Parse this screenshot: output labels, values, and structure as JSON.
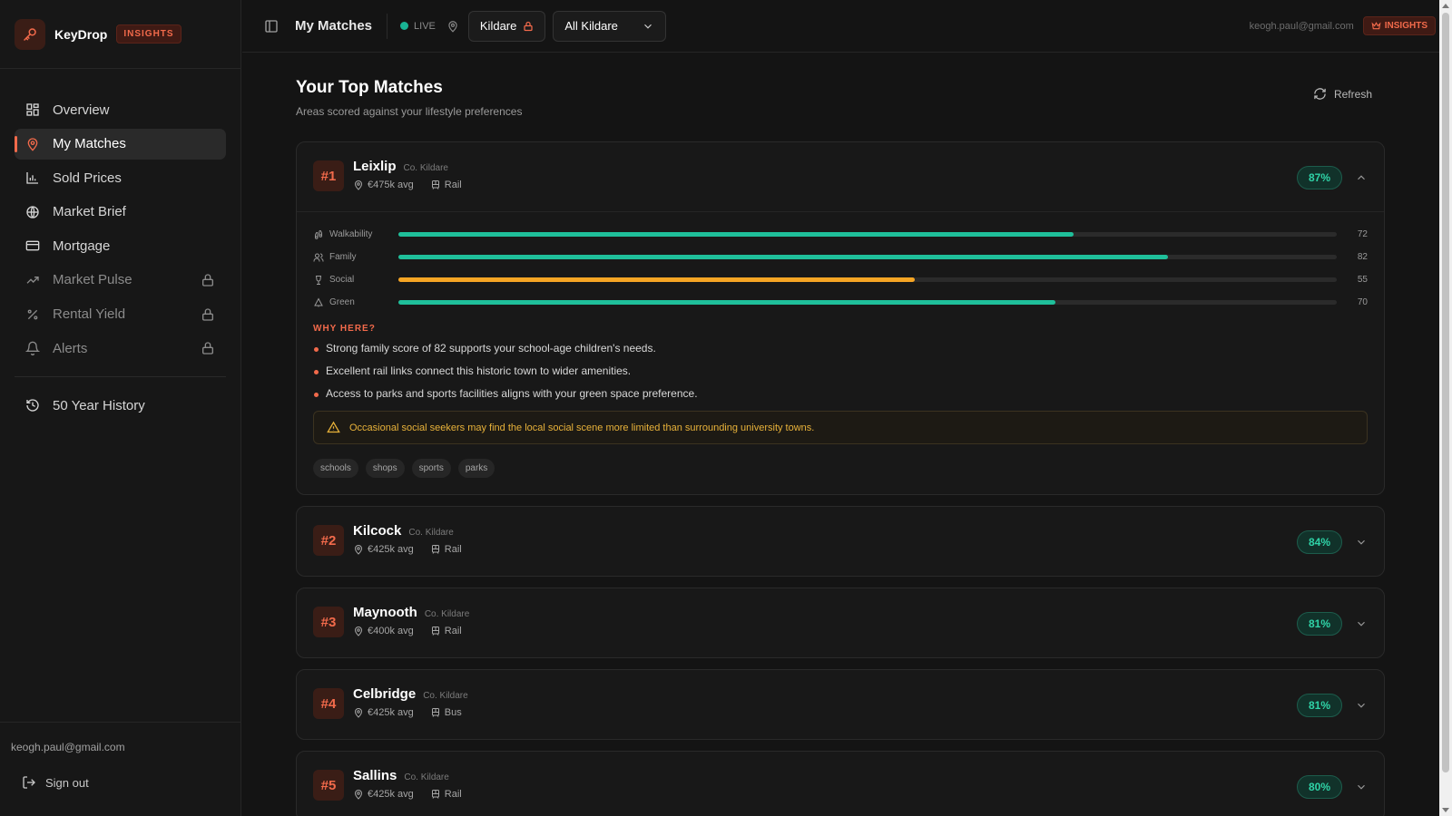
{
  "brand": {
    "name": "KeyDrop",
    "badge": "INSIGHTS"
  },
  "sidebar": {
    "items": [
      {
        "label": "Overview",
        "icon": "grid-icon",
        "active": false,
        "locked": false
      },
      {
        "label": "My Matches",
        "icon": "map-pin-icon",
        "active": true,
        "locked": false
      },
      {
        "label": "Sold Prices",
        "icon": "bar-chart-icon",
        "active": false,
        "locked": false
      },
      {
        "label": "Market Brief",
        "icon": "globe-icon",
        "active": false,
        "locked": false
      },
      {
        "label": "Mortgage",
        "icon": "credit-card-icon",
        "active": false,
        "locked": false
      },
      {
        "label": "Market Pulse",
        "icon": "trending-up-icon",
        "active": false,
        "locked": true
      },
      {
        "label": "Rental Yield",
        "icon": "percent-icon",
        "active": false,
        "locked": true
      },
      {
        "label": "Alerts",
        "icon": "bell-icon",
        "active": false,
        "locked": true
      }
    ],
    "history_label": "50 Year History",
    "email": "keogh.paul@gmail.com",
    "signout_label": "Sign out"
  },
  "topbar": {
    "title": "My Matches",
    "live_label": "LIVE",
    "county_chip": "Kildare",
    "area_select": "All Kildare",
    "email": "keogh.paul@gmail.com",
    "badge": "INSIGHTS"
  },
  "main": {
    "title": "Your Top Matches",
    "subtitle": "Areas scored against your lifestyle preferences",
    "refresh_label": "Refresh"
  },
  "matches": [
    {
      "rank": "#1",
      "name": "Leixlip",
      "county": "Co. Kildare",
      "price": "€475k avg",
      "transport": "Rail",
      "score": "87%",
      "expanded": true,
      "metrics": [
        {
          "label": "Walkability",
          "icon": "footprints-icon",
          "value": "72",
          "fraction": 0.72,
          "color": "#1fbf9a"
        },
        {
          "label": "Family",
          "icon": "users-icon",
          "value": "82",
          "fraction": 0.82,
          "color": "#1fbf9a"
        },
        {
          "label": "Social",
          "icon": "glass-icon",
          "value": "55",
          "fraction": 0.55,
          "color": "#f5a524"
        },
        {
          "label": "Green",
          "icon": "tree-icon",
          "value": "70",
          "fraction": 0.7,
          "color": "#1fbf9a"
        }
      ],
      "why_label": "WHY HERE?",
      "reasons": [
        "Strong family score of 82 supports your school-age children's needs.",
        "Excellent rail links connect this historic town to wider amenities.",
        "Access to parks and sports facilities aligns with your green space preference."
      ],
      "warning": "Occasional social seekers may find the local social scene more limited than surrounding university towns.",
      "tags": [
        "schools",
        "shops",
        "sports",
        "parks"
      ]
    },
    {
      "rank": "#2",
      "name": "Kilcock",
      "county": "Co. Kildare",
      "price": "€425k avg",
      "transport": "Rail",
      "score": "84%",
      "expanded": false
    },
    {
      "rank": "#3",
      "name": "Maynooth",
      "county": "Co. Kildare",
      "price": "€400k avg",
      "transport": "Rail",
      "score": "81%",
      "expanded": false
    },
    {
      "rank": "#4",
      "name": "Celbridge",
      "county": "Co. Kildare",
      "price": "€425k avg",
      "transport": "Bus",
      "score": "81%",
      "expanded": false
    },
    {
      "rank": "#5",
      "name": "Sallins",
      "county": "Co. Kildare",
      "price": "€425k avg",
      "transport": "Rail",
      "score": "80%",
      "expanded": false
    }
  ],
  "colors": {
    "accent": "#f26a4b",
    "good": "#1fbf9a",
    "warn": "#f5a524",
    "background": "#141414"
  }
}
